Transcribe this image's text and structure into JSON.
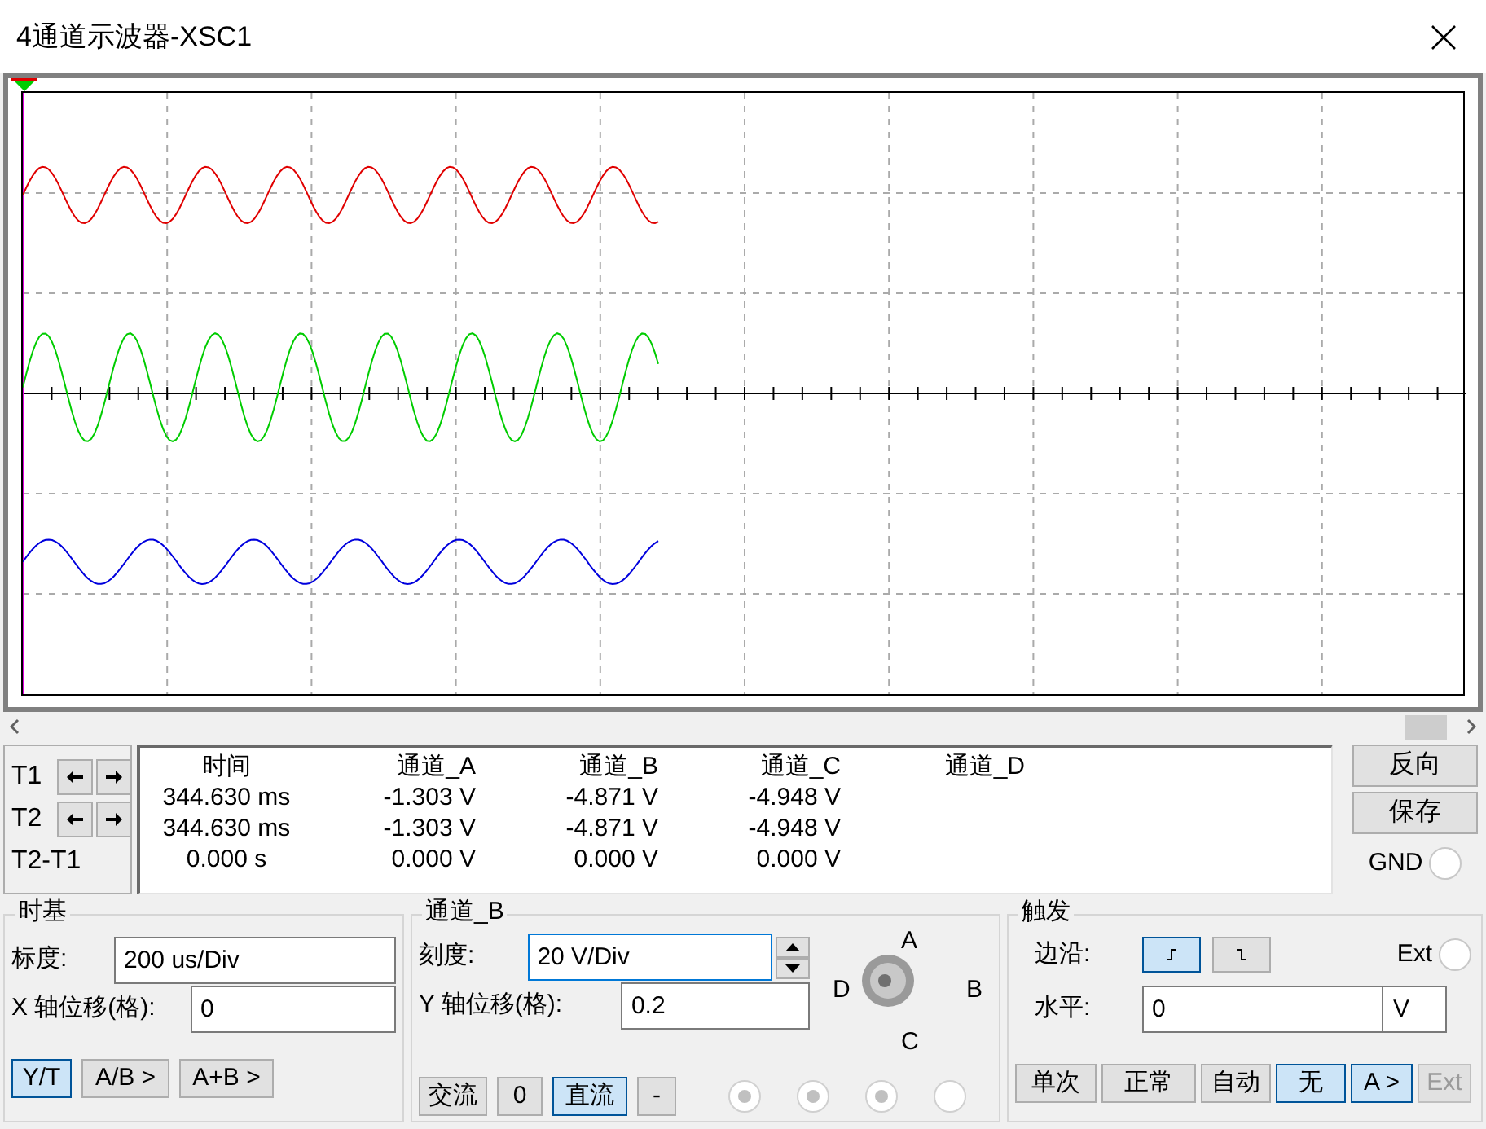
{
  "window": {
    "title": "4通道示波器-XSC1"
  },
  "scope": {
    "traces": [
      {
        "color": "#e00000"
      },
      {
        "color": "#00cc00"
      },
      {
        "color": "#0000dd"
      }
    ]
  },
  "cursors": {
    "rows": [
      "T1",
      "T2",
      "T2-T1"
    ]
  },
  "readout": {
    "columns": [
      "时间",
      "通道_A",
      "通道_B",
      "通道_C",
      "通道_D"
    ],
    "rows": [
      [
        "344.630 ms",
        "-1.303 V",
        "-4.871 V",
        "-4.948 V"
      ],
      [
        "344.630 ms",
        "-1.303 V",
        "-4.871 V",
        "-4.948 V"
      ],
      [
        "0.000 s",
        "0.000 V",
        "0.000 V",
        "0.000 V"
      ]
    ]
  },
  "side_buttons": [
    "反向",
    "保存"
  ],
  "gnd": {
    "label": "GND",
    "checked": false
  },
  "timebase": {
    "title": "时基",
    "scale_label": "标度:",
    "scale": "200 us/Div",
    "xpos_label": "X 轴位移(格):",
    "xpos": "0",
    "modes": [
      {
        "label": "Y/T",
        "selected": true
      },
      {
        "label": "A/B >",
        "selected": false
      },
      {
        "label": "A+B >",
        "selected": false
      }
    ]
  },
  "channel": {
    "title": "通道_B",
    "scale_label": "刻度:",
    "scale": "20  V/Div",
    "ypos_label": "Y 轴位移(格):",
    "ypos": "0.2",
    "coupling": [
      {
        "label": "交流",
        "selected": false
      },
      {
        "label": "0",
        "selected": false
      },
      {
        "label": "直流",
        "selected": true
      },
      {
        "label": "-",
        "selected": false
      }
    ],
    "knob_labels": [
      "A",
      "B",
      "C",
      "D"
    ],
    "radios": [
      {
        "checked": true
      },
      {
        "checked": true
      },
      {
        "checked": true
      },
      {
        "checked": false
      }
    ]
  },
  "trigger": {
    "title": "触发",
    "edge_label": "边沿:",
    "edges": [
      {
        "kind": "rising",
        "selected": true
      },
      {
        "kind": "falling",
        "selected": false
      }
    ],
    "ext": {
      "label": "Ext",
      "checked": false
    },
    "level_label": "水平:",
    "level": "0",
    "unit": "V",
    "modes": [
      {
        "label": "单次",
        "selected": false,
        "disabled": false
      },
      {
        "label": "正常",
        "selected": false,
        "disabled": false
      },
      {
        "label": "自动",
        "selected": false,
        "disabled": false
      },
      {
        "label": "无",
        "selected": true,
        "disabled": false
      },
      {
        "label": "A >",
        "selected": true,
        "disabled": false
      },
      {
        "label": "Ext",
        "selected": false,
        "disabled": true
      }
    ]
  }
}
